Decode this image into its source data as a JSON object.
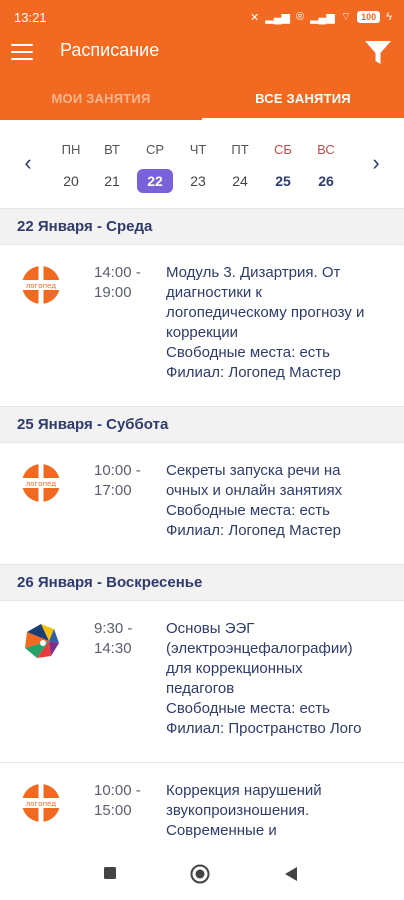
{
  "status_bar": {
    "time": "13:21",
    "battery": "100"
  },
  "app_bar": {
    "title": "Расписание"
  },
  "tabs": [
    {
      "label": "МОИ ЗАНЯТИЯ",
      "active": false
    },
    {
      "label": "ВСЕ ЗАНЯТИЯ",
      "active": true
    }
  ],
  "calendar": {
    "days": [
      {
        "dow": "ПН",
        "num": "20"
      },
      {
        "dow": "ВТ",
        "num": "21"
      },
      {
        "dow": "СР",
        "num": "22",
        "selected": true
      },
      {
        "dow": "ЧТ",
        "num": "23"
      },
      {
        "dow": "ПТ",
        "num": "24"
      },
      {
        "dow": "СБ",
        "num": "25",
        "weekend": true
      },
      {
        "dow": "ВС",
        "num": "26",
        "weekend": true
      }
    ]
  },
  "groups": [
    {
      "date": "22 Января - Среда",
      "events": [
        {
          "logo": "logoped-logo",
          "start": "14:00 -",
          "end": "19:00",
          "title_lines": [
            "Модуль 3. Дизартрия. От",
            "диагностики к",
            "логопедическому прогнозу и",
            "коррекции"
          ],
          "seats": "Свободные места: есть",
          "branch": "Филиал: Логопед Мастер"
        }
      ]
    },
    {
      "date": "25 Января - Суббота",
      "events": [
        {
          "logo": "logoped-logo",
          "start": "10:00 -",
          "end": "17:00",
          "title_lines": [
            "Секреты запуска речи на",
            "очных и онлайн занятиях"
          ],
          "seats": "Свободные места: есть",
          "branch": "Филиал: Логопед Мастер"
        }
      ]
    },
    {
      "date": "26 Января - Воскресенье",
      "events": [
        {
          "logo": "brain-logo",
          "start": "9:30 -",
          "end": "14:30",
          "title_lines": [
            "Основы ЭЭГ",
            "(электроэнцефалографии)",
            "для коррекционных",
            "педагогов"
          ],
          "seats": "Свободные места: есть",
          "branch": "Филиал: Пространство Лого"
        },
        {
          "logo": "logoped-logo",
          "start": "10:00 -",
          "end": "15:00",
          "title_lines": [
            "Коррекция нарушений",
            "звукопроизношения.",
            "Современные и"
          ],
          "seats": "",
          "branch": ""
        }
      ]
    }
  ],
  "logo_text": "логопед",
  "colors": {
    "primary": "#f26a21",
    "selected_day": "#7b61d9",
    "text_dark": "#2f3b6b"
  }
}
